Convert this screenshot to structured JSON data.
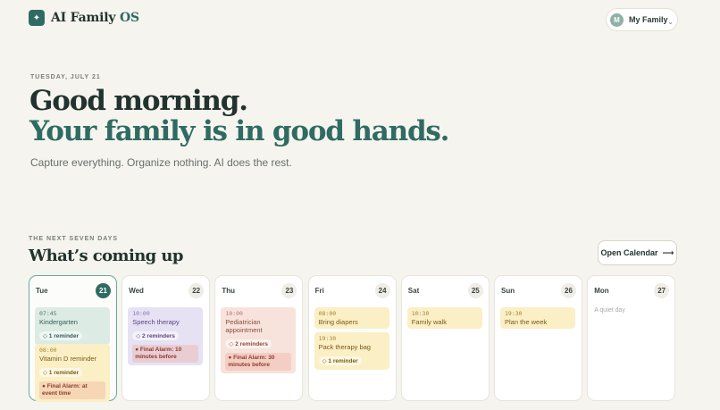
{
  "app": {
    "logo_icon": "✦",
    "name_main": "AI Family",
    "name_accent": "OS"
  },
  "account": {
    "avatar_letter": "M",
    "label": "My Family",
    "chevron": "⌄"
  },
  "hero": {
    "date": "TUESDAY, JULY 21",
    "line1": "Good morning.",
    "line2": "Your family is in good hands.",
    "tagline": "Capture everything. Organize nothing. AI does the rest."
  },
  "upcoming": {
    "label": "THE NEXT SEVEN DAYS",
    "title": "What’s coming up",
    "calendar_button": "Open Calendar",
    "calendar_arrow": "⟶"
  },
  "days": [
    {
      "name": "Tue",
      "num": "21",
      "today": true,
      "events": [
        {
          "time": "07:45",
          "title": "Kindergarten",
          "chip": "◇ 1 reminder",
          "color": "green"
        },
        {
          "time": "08:00",
          "title": "Vitamin D reminder",
          "chip": "◇ 1 reminder",
          "alarm": "● Final Alarm: at event time",
          "color": "yellow"
        }
      ]
    },
    {
      "name": "Wed",
      "num": "22",
      "events": [
        {
          "time": "10:00",
          "title": "Speech therapy",
          "chip": "◇ 2 reminders",
          "alarm": "● Final Alarm: 10 minutes before",
          "color": "purple"
        }
      ]
    },
    {
      "name": "Thu",
      "num": "23",
      "events": [
        {
          "time": "10:00",
          "title": "Pediatrician appointment",
          "chip": "◇ 2 reminders",
          "alarm": "● Final Alarm: 30 minutes before",
          "color": "pink"
        }
      ]
    },
    {
      "name": "Fri",
      "num": "24",
      "events": [
        {
          "time": "08:00",
          "title": "Bring diapers",
          "color": "yellow"
        },
        {
          "time": "19:30",
          "title": "Pack therapy bag",
          "chip": "◇ 1 reminder",
          "color": "yellow"
        }
      ]
    },
    {
      "name": "Sat",
      "num": "25",
      "events": [
        {
          "time": "10:30",
          "title": "Family walk",
          "color": "yellow"
        }
      ]
    },
    {
      "name": "Sun",
      "num": "26",
      "events": [
        {
          "time": "19:30",
          "title": "Plan the week",
          "color": "yellow"
        }
      ]
    },
    {
      "name": "Mon",
      "num": "27",
      "quiet": "A quiet day",
      "events": []
    }
  ]
}
